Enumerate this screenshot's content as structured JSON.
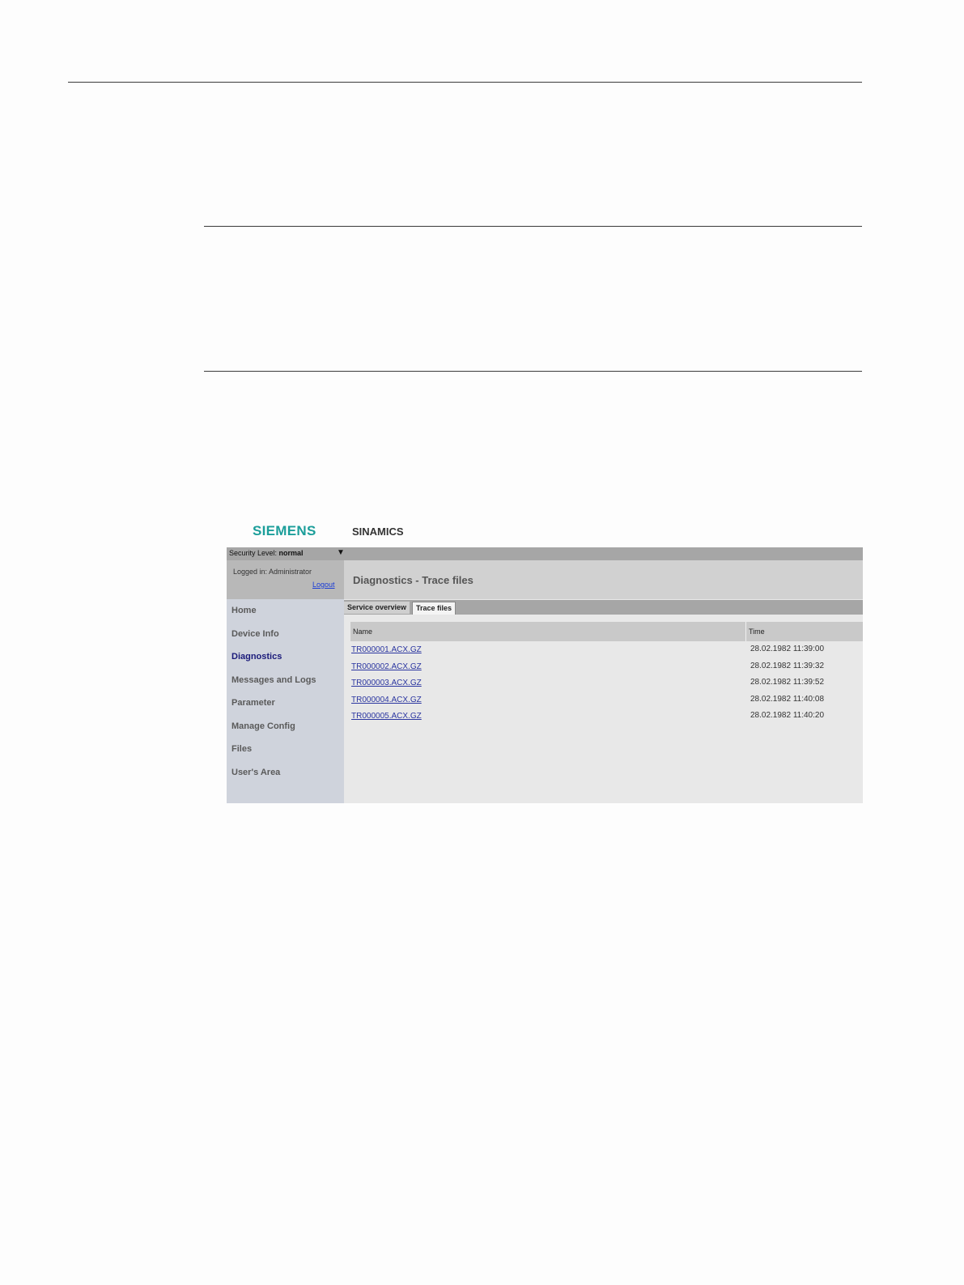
{
  "brand": {
    "logo": "SIEMENS",
    "product": "SINAMICS"
  },
  "security": {
    "label": "Security Level:",
    "value": "normal",
    "dropdown_icon": "triangle-down-icon"
  },
  "login": {
    "text": "Logged in: Administrator",
    "logout": "Logout"
  },
  "sidebar": {
    "items": [
      {
        "label": "Home"
      },
      {
        "label": "Device Info"
      },
      {
        "label": "Diagnostics"
      },
      {
        "label": "Messages and Logs"
      },
      {
        "label": "Parameter"
      },
      {
        "label": "Manage Config"
      },
      {
        "label": "Files"
      },
      {
        "label": "User's Area"
      }
    ],
    "active": "Diagnostics"
  },
  "content": {
    "title": "Diagnostics - Trace files",
    "tabs": [
      {
        "label": "Service overview"
      },
      {
        "label": "Trace files"
      }
    ],
    "active_tab": "Trace files"
  },
  "table": {
    "headers": {
      "name": "Name",
      "time": "Time"
    },
    "rows": [
      {
        "name": "TR000001.ACX.GZ",
        "time": "28.02.1982 11:39:00"
      },
      {
        "name": "TR000002.ACX.GZ",
        "time": "28.02.1982 11:39:32"
      },
      {
        "name": "TR000003.ACX.GZ",
        "time": "28.02.1982 11:39:52"
      },
      {
        "name": "TR000004.ACX.GZ",
        "time": "28.02.1982 11:40:08"
      },
      {
        "name": "TR000005.ACX.GZ",
        "time": "28.02.1982 11:40:20"
      }
    ]
  },
  "colors": {
    "siemens_teal": "#1b9e9a",
    "link_blue": "#2a35a0",
    "active_nav": "#1a1a7a"
  }
}
